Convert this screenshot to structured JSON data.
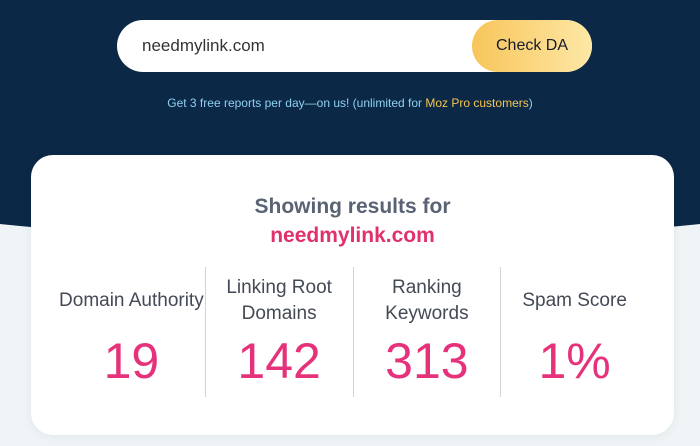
{
  "search": {
    "value": "needmylink.com",
    "button_label": "Check DA"
  },
  "promo": {
    "text_before": "Get 3 free reports per day—on us! (unlimited for ",
    "highlight": "Moz Pro customers",
    "text_after": ")"
  },
  "results": {
    "heading": "Showing results for",
    "domain": "needmylink.com",
    "metrics": [
      {
        "label": "Domain Authority",
        "value": "19"
      },
      {
        "label": "Linking Root Domains",
        "value": "142"
      },
      {
        "label": "Ranking Keywords",
        "value": "313"
      },
      {
        "label": "Spam Score",
        "value": "1%"
      }
    ]
  },
  "colors": {
    "hero_bg": "#0b2847",
    "accent_pink": "#e5327a",
    "button_gold": "#f8c55a",
    "promo_blue": "#8fd0ef",
    "promo_highlight": "#f5c64f"
  }
}
